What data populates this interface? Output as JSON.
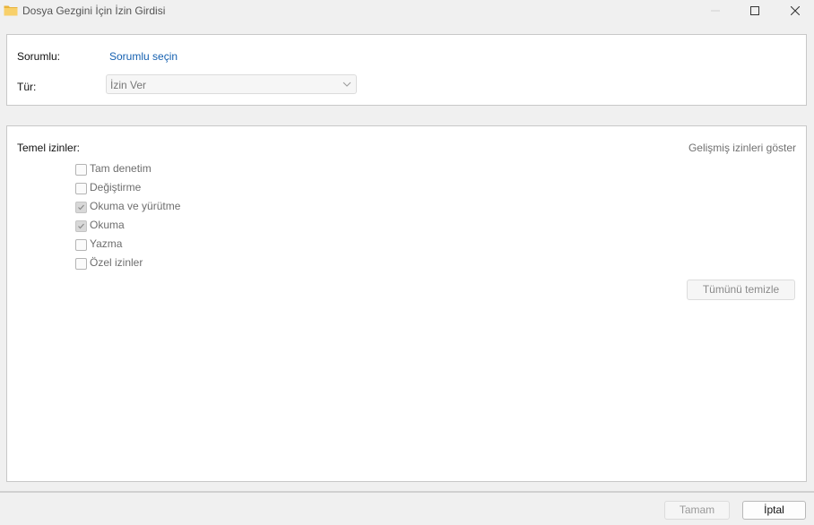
{
  "window": {
    "title": "Dosya Gezgini İçin İzin Girdisi",
    "icon": "folder-icon",
    "controls": [
      "minimize-icon",
      "maximize-icon",
      "close-icon"
    ]
  },
  "principal": {
    "label": "Sorumlu:",
    "link": "Sorumlu seçin"
  },
  "type": {
    "label": "Tür:",
    "value": "İzin Ver"
  },
  "permissions": {
    "label": "Temel izinler:",
    "advanced_link": "Gelişmiş izinleri göster",
    "items": [
      {
        "label": "Tam denetim",
        "checked": false
      },
      {
        "label": "Değiştirme",
        "checked": false
      },
      {
        "label": "Okuma ve yürütme",
        "checked": true
      },
      {
        "label": "Okuma",
        "checked": true
      },
      {
        "label": "Yazma",
        "checked": false
      },
      {
        "label": "Özel izinler",
        "checked": false
      }
    ],
    "clear_all": "Tümünü temizle"
  },
  "footer": {
    "ok": "Tamam",
    "cancel": "İptal"
  },
  "colors": {
    "link": "#1560b0",
    "folder": "#f4c542"
  }
}
